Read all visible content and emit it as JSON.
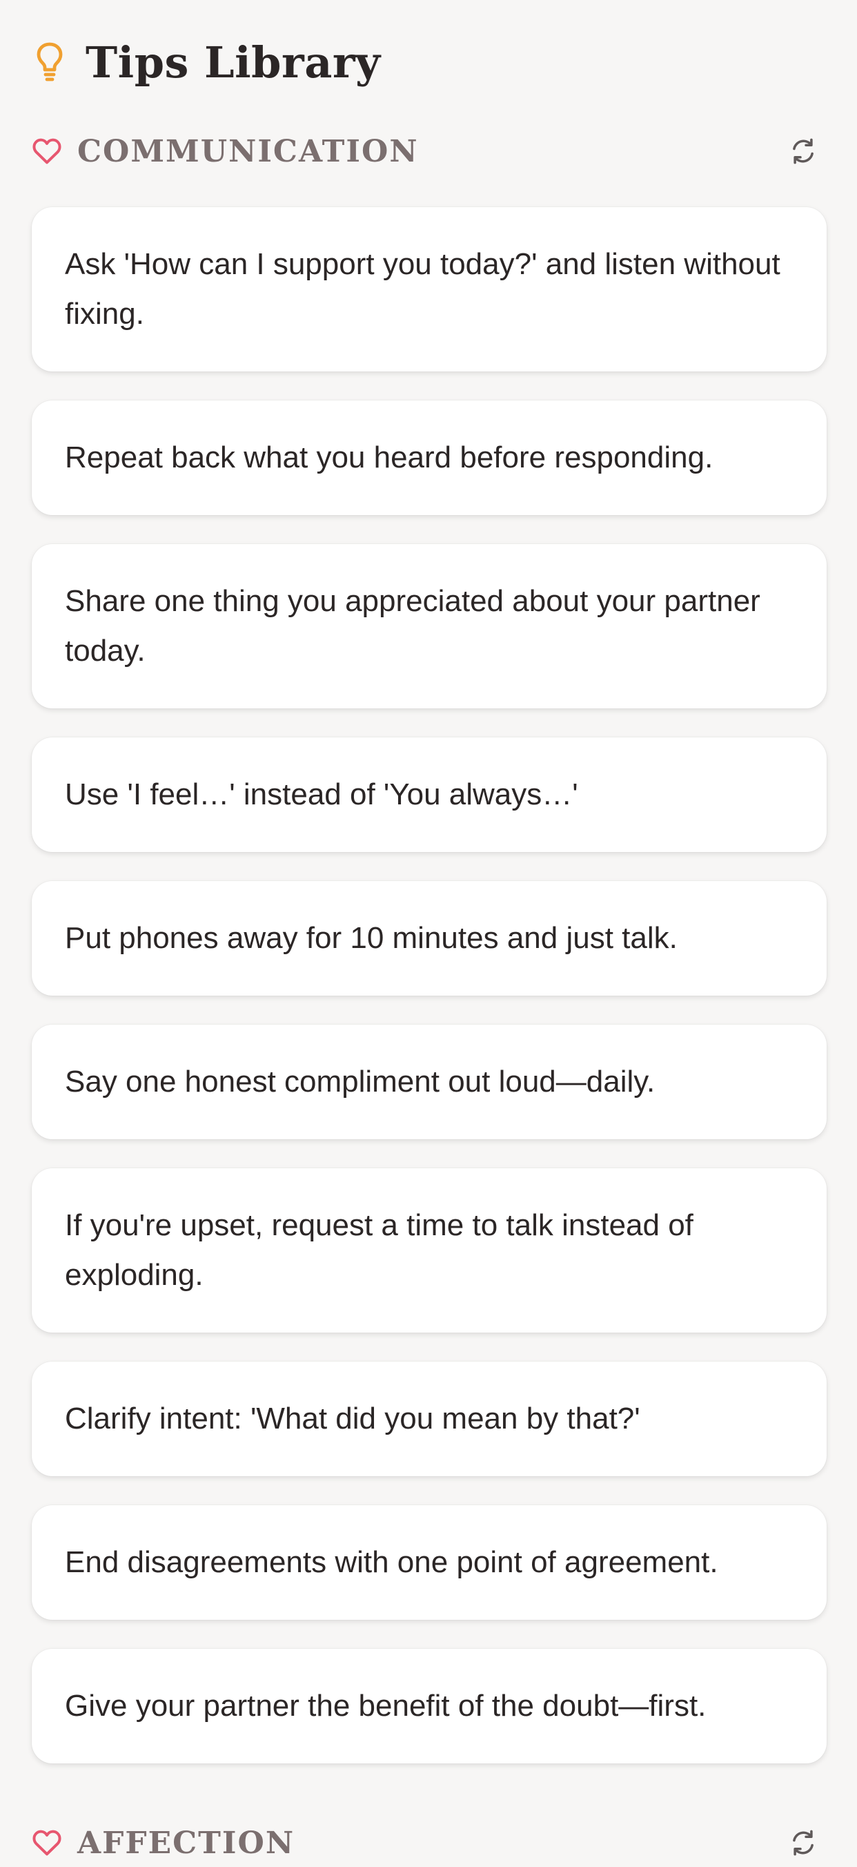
{
  "header": {
    "title": "Tips Library",
    "icon": "lightbulb-icon",
    "icon_color": "#f0a030"
  },
  "colors": {
    "heart": "#e7566f",
    "section_title": "#7b6f6f",
    "background": "#f7f6f5",
    "card": "#ffffff"
  },
  "sections": [
    {
      "title": "COMMUNICATION",
      "icon": "heart-icon",
      "action_icon": "refresh-icon",
      "tips": [
        "Ask 'How can I support you today?' and listen without fixing.",
        "Repeat back what you heard before responding.",
        "Share one thing you appreciated about your partner today.",
        "Use 'I feel…' instead of 'You always…'",
        "Put phones away for 10 minutes and just talk.",
        "Say one honest compliment out loud—daily.",
        "If you're upset, request a time to talk instead of exploding.",
        "Clarify intent: 'What did you mean by that?'",
        "End disagreements with one point of agreement.",
        "Give your partner the benefit of the doubt—first."
      ]
    },
    {
      "title": "AFFECTION",
      "icon": "heart-icon",
      "action_icon": "refresh-icon",
      "tips": []
    }
  ]
}
